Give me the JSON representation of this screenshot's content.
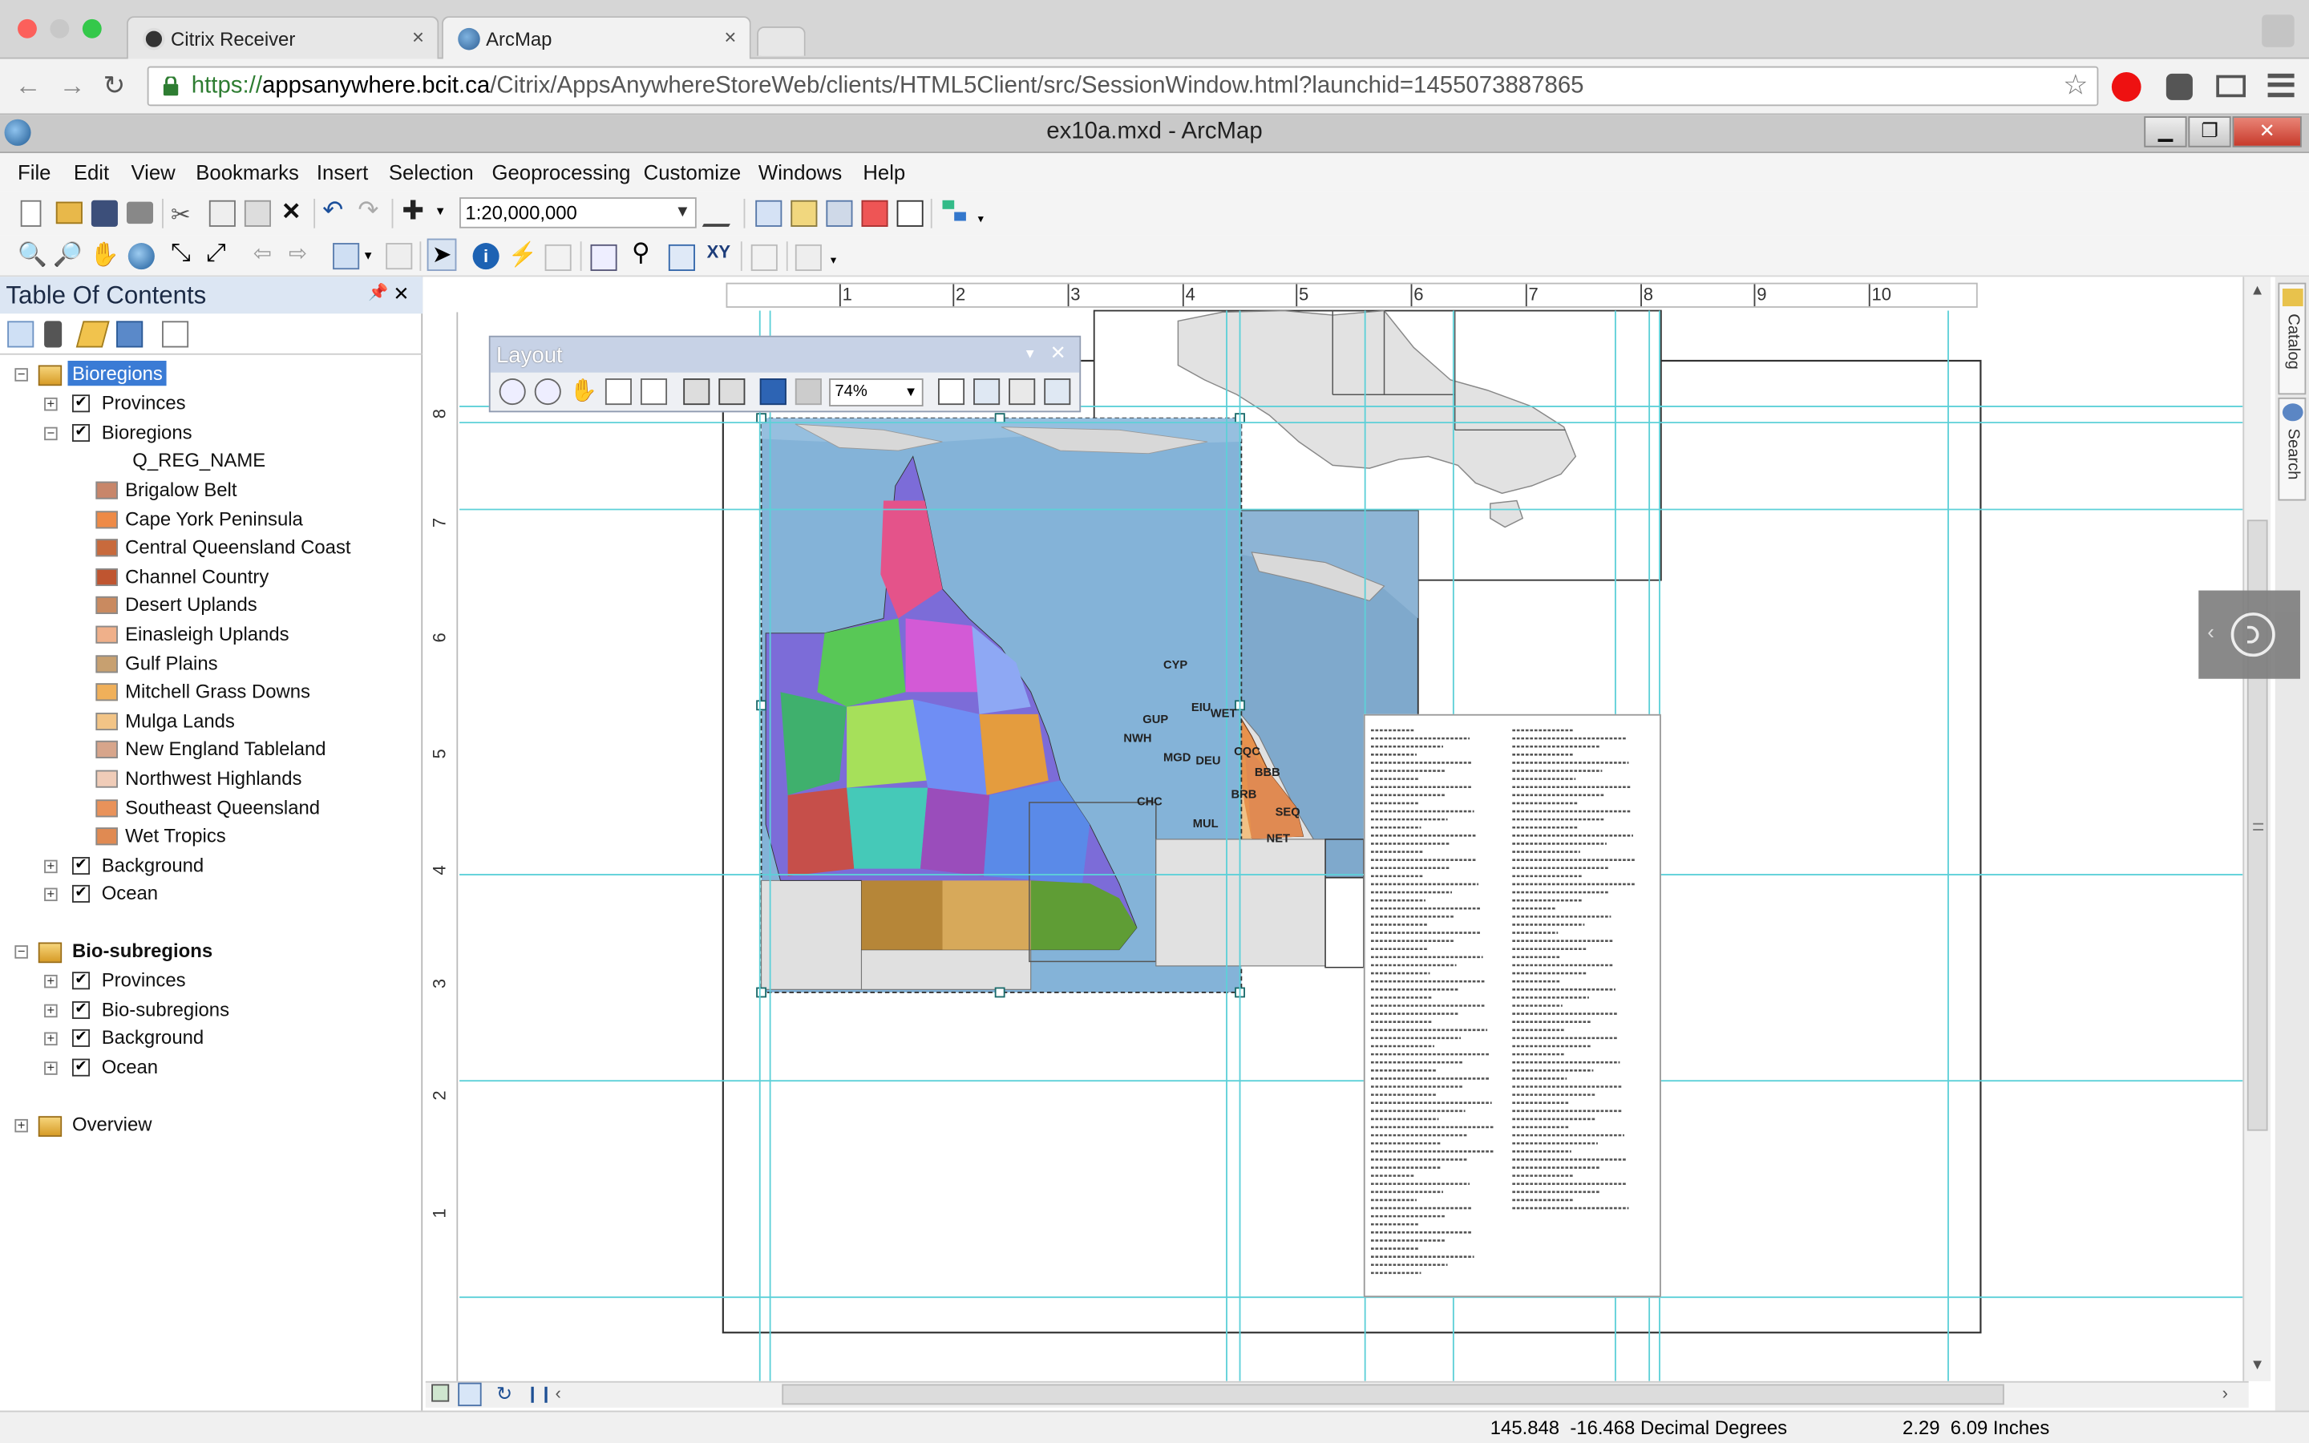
{
  "browser": {
    "tabs": [
      {
        "label": "Citrix Receiver",
        "close": "×",
        "icon": "citrix-receiver-icon"
      },
      {
        "label": "ArcMap",
        "close": "×",
        "icon": "arcmap-globe-icon"
      }
    ],
    "url_scheme": "https://",
    "url_host": "appsanywhere.bcit.ca",
    "url_path": "/Citrix/AppsAnywhereStoreWeb/clients/HTML5Client/src/SessionWindow.html?launchid=1455073887865"
  },
  "app": {
    "title": "ex10a.mxd - ArcMap",
    "menus": [
      "File",
      "Edit",
      "View",
      "Bookmarks",
      "Insert",
      "Selection",
      "Geoprocessing",
      "Customize",
      "Windows",
      "Help"
    ],
    "scale_value": "1:20,000,000",
    "window_controls": {
      "minimize": "▁",
      "restore": "❐",
      "close": "✕"
    }
  },
  "toc": {
    "title": "Table Of Contents",
    "pin": "📌",
    "close": "✕",
    "frames": [
      {
        "name": "Bioregions",
        "selected": true,
        "layers": [
          {
            "name": "Provinces",
            "checked": true,
            "expanded": false
          },
          {
            "name": "Bioregions",
            "checked": true,
            "expanded": true,
            "field": "Q_REG_NAME",
            "classes": [
              {
                "label": "Brigalow Belt",
                "color": "#c8866a"
              },
              {
                "label": "Cape York Peninsula",
                "color": "#ee8a46"
              },
              {
                "label": "Central Queensland Coast",
                "color": "#c86a3c"
              },
              {
                "label": "Channel Country",
                "color": "#bf5530"
              },
              {
                "label": "Desert Uplands",
                "color": "#c98a60"
              },
              {
                "label": "Einasleigh Uplands",
                "color": "#efb08a"
              },
              {
                "label": "Gulf Plains",
                "color": "#c7a070"
              },
              {
                "label": "Mitchell Grass Downs",
                "color": "#f0b05a"
              },
              {
                "label": "Mulga Lands",
                "color": "#f2c486"
              },
              {
                "label": "New England Tableland",
                "color": "#d7a58b"
              },
              {
                "label": "Northwest Highlands",
                "color": "#f0ccb8"
              },
              {
                "label": "Southeast Queensland",
                "color": "#e9925a"
              },
              {
                "label": "Wet Tropics",
                "color": "#e08a52"
              }
            ]
          },
          {
            "name": "Background",
            "checked": true,
            "expanded": false
          },
          {
            "name": "Ocean",
            "checked": true,
            "expanded": false
          }
        ]
      },
      {
        "name": "Bio-subregions",
        "selected": false,
        "layers": [
          {
            "name": "Provinces",
            "checked": true
          },
          {
            "name": "Bio-subregions",
            "checked": true
          },
          {
            "name": "Background",
            "checked": true
          },
          {
            "name": "Ocean",
            "checked": true
          }
        ]
      },
      {
        "name": "Overview",
        "selected": false,
        "layers": []
      }
    ]
  },
  "layout_toolbar": {
    "title": "Layout",
    "zoom": "74%"
  },
  "ruler": {
    "top_ticks": [
      "1",
      "2",
      "3",
      "4",
      "5",
      "6",
      "7",
      "8",
      "9",
      "10"
    ],
    "left_ticks": [
      "8",
      "7",
      "6",
      "5",
      "4",
      "3",
      "2",
      "1"
    ]
  },
  "map_labels": [
    "CYP",
    "GUP",
    "EIU",
    "WET",
    "NWH",
    "MGD",
    "DEU",
    "CQC",
    "BBB",
    "BRB",
    "CHC",
    "MUL",
    "SEQ",
    "NET"
  ],
  "right_panel": {
    "catalog": "Catalog",
    "search": "Search"
  },
  "status": {
    "coords": "145.848  -16.468 Decimal Degrees",
    "page_coords": "2.29  6.09 Inches"
  }
}
